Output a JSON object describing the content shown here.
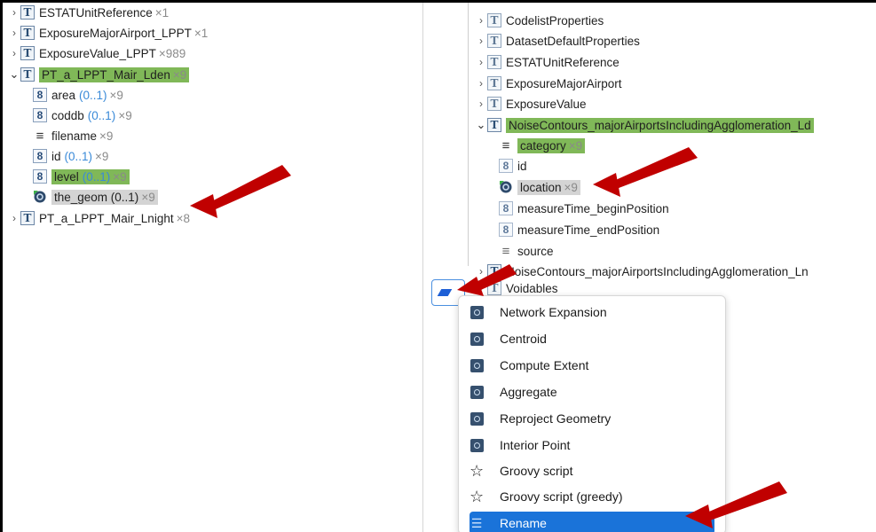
{
  "left_tree": [
    {
      "name": "ESTATUnitReference",
      "type": "T",
      "count": "×1",
      "expanded": false,
      "level": 0
    },
    {
      "name": "ExposureMajorAirport_LPPT",
      "type": "T",
      "count": "×1",
      "expanded": false,
      "level": 0
    },
    {
      "name": "ExposureValue_LPPT",
      "type": "T",
      "count": "×989",
      "expanded": false,
      "level": 0
    },
    {
      "name": "PT_a_LPPT_Mair_Lden",
      "type": "T",
      "count": "×9",
      "expanded": true,
      "level": 0,
      "highlight": "green"
    },
    {
      "name": "area",
      "type": "8",
      "card": "(0..1)",
      "count": "×9",
      "level": 1
    },
    {
      "name": "coddb",
      "type": "8",
      "card": "(0..1)",
      "count": "×9",
      "level": 1
    },
    {
      "name": "filename",
      "type": "list",
      "count": "×9",
      "level": 1
    },
    {
      "name": "id",
      "type": "8",
      "card": "(0..1)",
      "count": "×9",
      "level": 1
    },
    {
      "name": "level",
      "type": "8",
      "card": "(0..1)",
      "count": "×9",
      "level": 1,
      "highlight": "green"
    },
    {
      "name": "the_geom (0..1)",
      "type": "geom",
      "count": "×9",
      "level": 1,
      "highlight": "gray"
    },
    {
      "name": "PT_a_LPPT_Mair_Lnight",
      "type": "T",
      "count": "×8",
      "expanded": false,
      "level": 0
    }
  ],
  "right_tree": [
    {
      "name": "CodelistProperties",
      "type": "T",
      "expanded": false,
      "level": 0
    },
    {
      "name": "DatasetDefaultProperties",
      "type": "T",
      "expanded": false,
      "level": 0
    },
    {
      "name": "ESTATUnitReference",
      "type": "T",
      "expanded": false,
      "level": 0
    },
    {
      "name": "ExposureMajorAirport",
      "type": "T",
      "expanded": false,
      "level": 0
    },
    {
      "name": "ExposureValue",
      "type": "T",
      "expanded": false,
      "level": 0
    },
    {
      "name": "NoiseContours_majorAirportsIncludingAgglomeration_Ld",
      "type": "T",
      "expanded": true,
      "level": 0,
      "highlight": "green"
    },
    {
      "name": "category",
      "type": "list",
      "count": "×9",
      "level": 1,
      "highlight": "green"
    },
    {
      "name": "id",
      "type": "8",
      "level": 1
    },
    {
      "name": "location",
      "type": "geom",
      "count": "×9",
      "level": 1,
      "highlight": "gray"
    },
    {
      "name": "measureTime_beginPosition",
      "type": "8",
      "level": 1
    },
    {
      "name": "measureTime_endPosition",
      "type": "8",
      "level": 1
    },
    {
      "name": "source",
      "type": "list",
      "level": 1
    },
    {
      "name": "NoiseContours_majorAirportsIncludingAgglomeration_Ln",
      "type": "T",
      "expanded": false,
      "level": 0
    },
    {
      "name": "Voidables",
      "type": "T",
      "expanded": false,
      "level": 0
    }
  ],
  "context_menu": {
    "items": [
      {
        "label": "Network Expansion",
        "icon": "function-icon"
      },
      {
        "label": "Centroid",
        "icon": "function-icon"
      },
      {
        "label": "Compute Extent",
        "icon": "function-icon"
      },
      {
        "label": "Aggregate",
        "icon": "function-icon"
      },
      {
        "label": "Reproject Geometry",
        "icon": "function-icon"
      },
      {
        "label": "Interior Point",
        "icon": "function-icon"
      },
      {
        "label": "Groovy script",
        "icon": "star-icon"
      },
      {
        "label": "Groovy script (greedy)",
        "icon": "star-icon"
      },
      {
        "label": "Rename",
        "icon": "rename-icon",
        "selected": true
      }
    ]
  },
  "colors": {
    "highlight_green": "#80b858",
    "highlight_gray": "#d4d4d4",
    "selection_blue": "#1a73d9",
    "annotation_arrow": "#c00000"
  }
}
